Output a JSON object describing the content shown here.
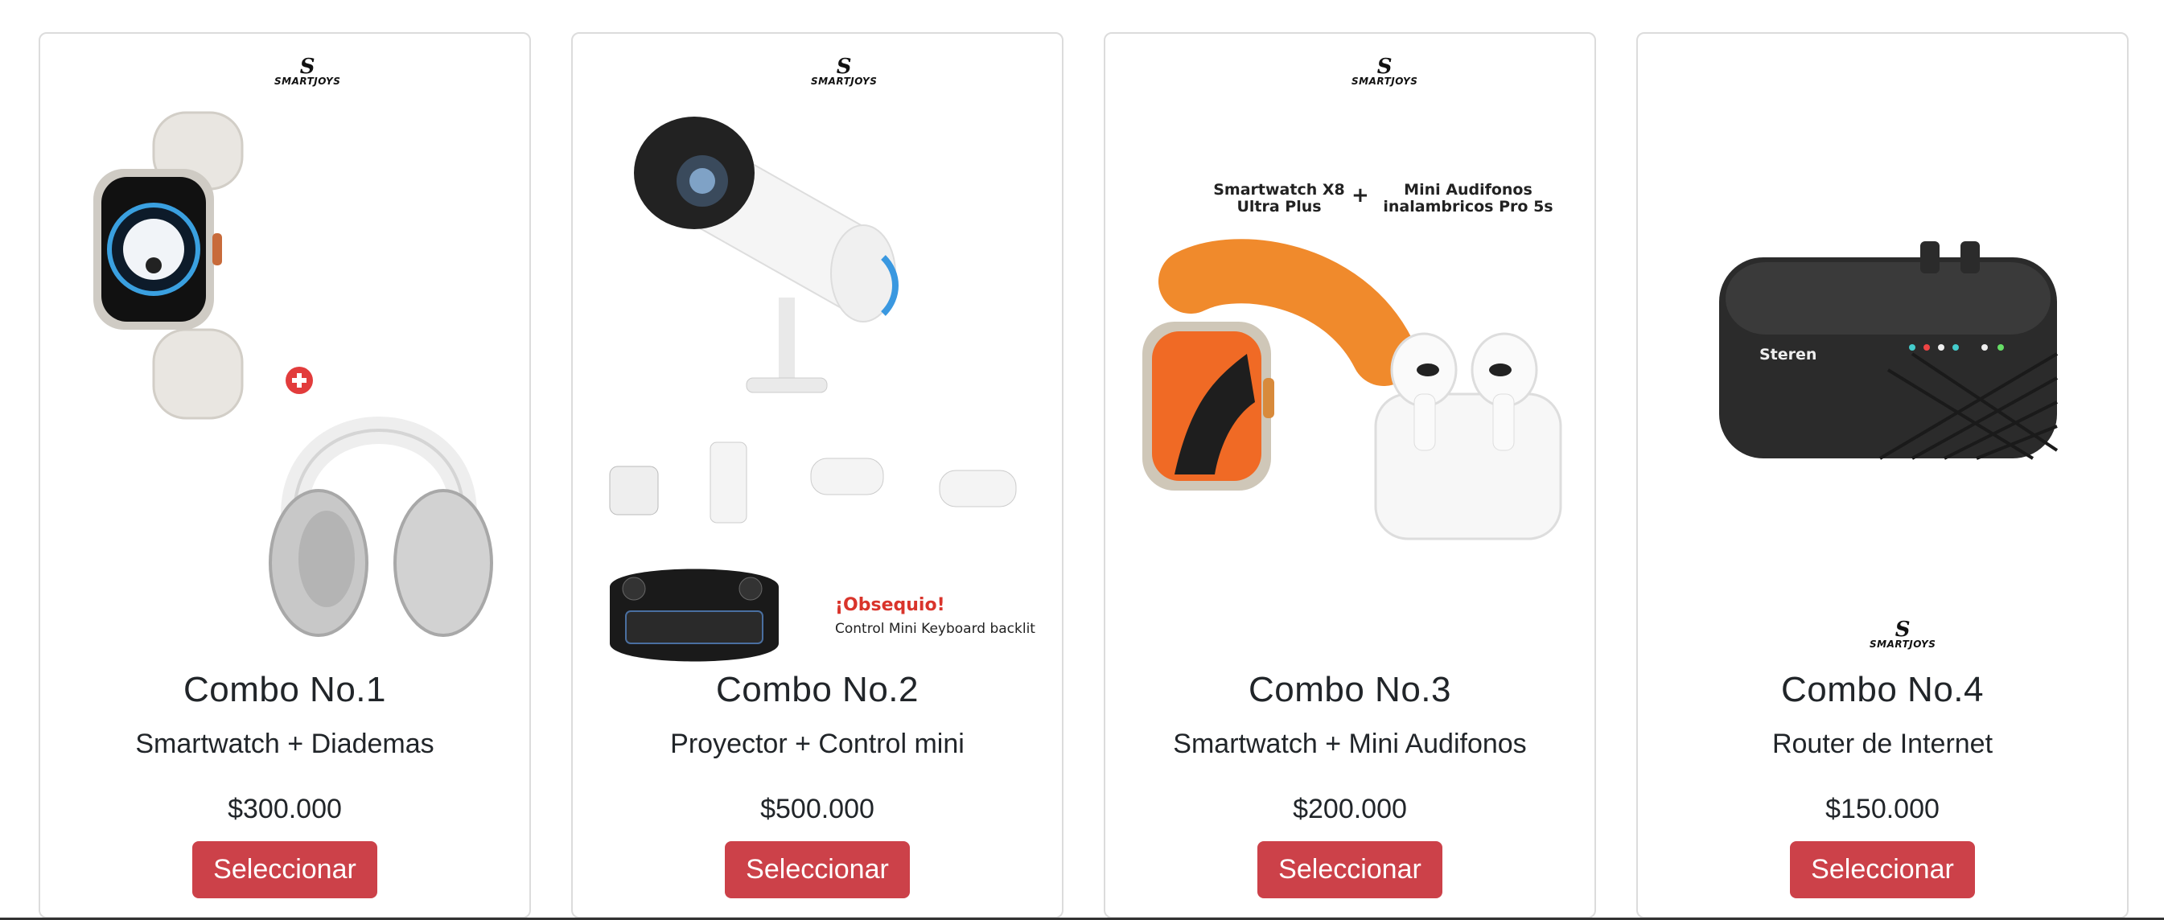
{
  "brand": {
    "mark": "S",
    "word": "SMARTJOYS"
  },
  "colors": {
    "button_bg": "#cc4149",
    "button_text": "#ffffff",
    "card_border": "#dcdcdc"
  },
  "cards": [
    {
      "title": "Combo No.1",
      "subtitle": "Smartwatch + Diademas",
      "price": "$300.000",
      "button": "Seleccionar",
      "image_icons": [
        "smartwatch-icon",
        "plus-badge-icon",
        "headphones-icon"
      ]
    },
    {
      "title": "Combo No.2",
      "subtitle": "Proyector + Control mini",
      "price": "$500.000",
      "button": "Seleccionar",
      "image_icons": [
        "projector-icon",
        "keyboard-icon"
      ],
      "gift_title": "¡Obsequio!",
      "gift_sub": "Control Mini Keyboard backlit"
    },
    {
      "title": "Combo No.3",
      "subtitle": "Smartwatch + Mini Audifonos",
      "price": "$200.000",
      "button": "Seleccionar",
      "image_icons": [
        "smartwatch-icon",
        "earbuds-icon"
      ],
      "caption_left": "Smartwatch X8\nUltra Plus",
      "caption_plus": "+",
      "caption_right": "Mini Audifonos\ninalambricos Pro 5s"
    },
    {
      "title": "Combo No.4",
      "subtitle": "Router de Internet",
      "price": "$150.000",
      "button": "Seleccionar",
      "image_icons": [
        "router-icon"
      ],
      "router_brand": "Steren"
    }
  ]
}
